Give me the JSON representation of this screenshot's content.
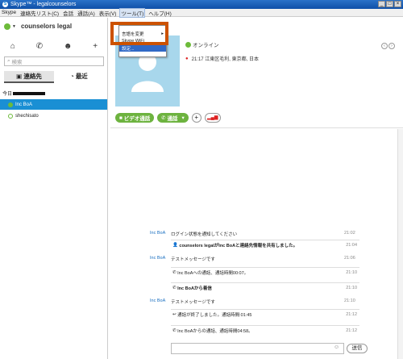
{
  "window": {
    "title": "Skype™ - legalcounselors"
  },
  "menubar": {
    "items": [
      "Skype",
      "連絡先リスト(C)",
      "会話",
      "通話(A)",
      "表示(V)",
      "ツール(T)",
      "ヘルプ(H)"
    ]
  },
  "tools_menu": {
    "items": [
      "言語を変更",
      "Skype WiFi",
      "設定..."
    ]
  },
  "profile": {
    "name": "counselors legal"
  },
  "search": {
    "placeholder": "検索"
  },
  "tabs": {
    "contacts": "連絡先",
    "recent": "最近"
  },
  "group_label": "今日",
  "contacts": [
    {
      "name": "Inc BoA",
      "selected": true
    },
    {
      "name": "shechisato",
      "selected": false
    }
  ],
  "contact_detail": {
    "status": "オンライン",
    "location": "21:17 江東区毛利, 東京都, 日本"
  },
  "actions": {
    "video_call": "ビデオ通話",
    "call": "通話"
  },
  "messages": [
    {
      "sender": "Inc BoA",
      "text": "ログイン状態を通知してください",
      "time": "21:02"
    },
    {
      "sender": "",
      "text": "counselors legalがInc BoAと連絡先情報を共有しました。",
      "time": "21:04"
    },
    {
      "sender": "Inc BoA",
      "text": "テストメッセージです",
      "time": "21:06"
    },
    {
      "sender": "",
      "text": "Inc BoAへの通話、通話時間00:07。",
      "time": "21:10"
    },
    {
      "sender": "",
      "text": "Inc BoAから着信",
      "time": "21:10"
    },
    {
      "sender": "Inc BoA",
      "text": "テストメッセージです",
      "time": "21:10"
    },
    {
      "sender": "",
      "text": "通話が終了しました。通話時間:01:45",
      "time": "21:12"
    },
    {
      "sender": "",
      "text": "Inc BoAからの通話、通話時間04:58。",
      "time": "21:12"
    }
  ],
  "input": {
    "send_label": "送信"
  }
}
